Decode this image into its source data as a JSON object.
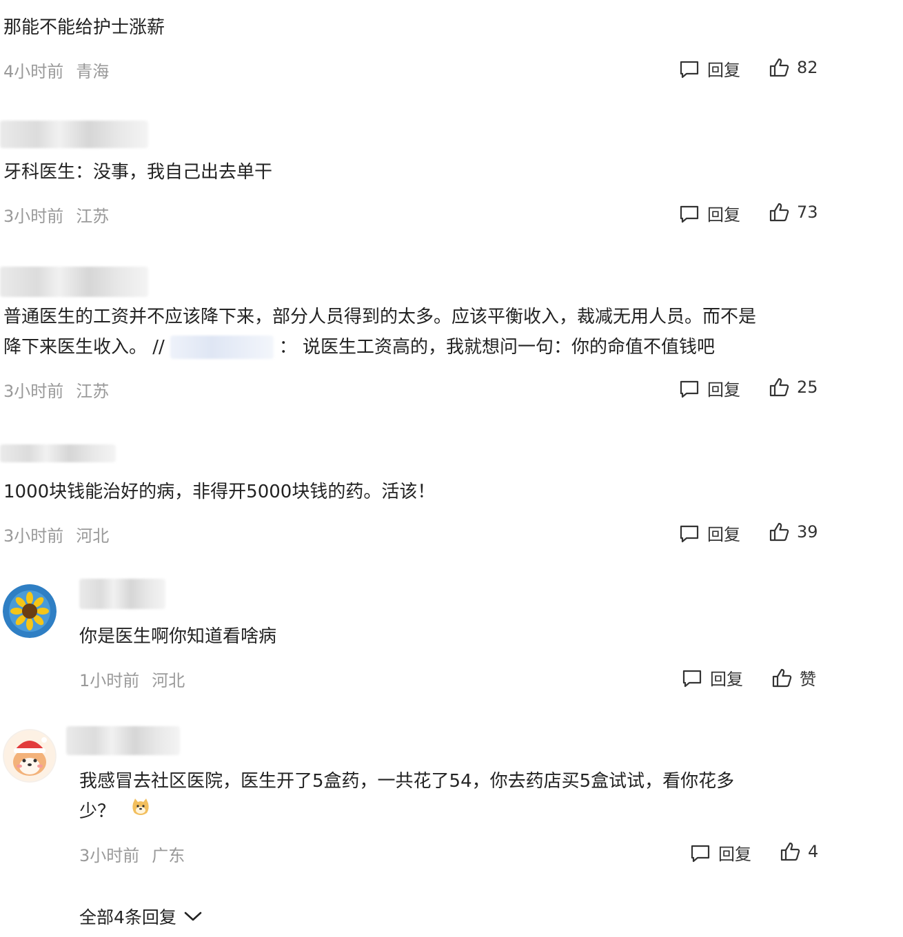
{
  "labels": {
    "reply": "回复",
    "like_zero": "赞"
  },
  "comments": [
    {
      "text": "那能不能给护士涨薪",
      "time": "4小时前",
      "location": "青海",
      "likes": "82"
    },
    {
      "text": "牙科医生：没事，我自己出去单干",
      "time": "3小时前",
      "location": "江苏",
      "likes": "73"
    },
    {
      "text_line1": "普通医生的工资并不应该降下来，部分人员得到的太多。应该平衡收入，裁减无用人员。而不是",
      "text_line2_a": "降下来医生收入。 //",
      "text_line2_b": "： 说医生工资高的，我就想问一句：你的命值不值钱吧",
      "time": "3小时前",
      "location": "江苏",
      "likes": "25"
    },
    {
      "text": "1000块钱能治好的病，非得开5000块钱的药。活该！",
      "time": "3小时前",
      "location": "河北",
      "likes": "39"
    },
    {
      "text": "你是医生啊你知道看啥病",
      "time": "1小时前",
      "location": "河北"
    },
    {
      "text_line1": "我感冒去社区医院，医生开了5盒药，一共花了54，你去药店买5盒试试，看你花多",
      "text_line2": "少？",
      "time": "3小时前",
      "location": "广东",
      "likes": "4"
    }
  ],
  "all_replies": "全部4条回复",
  "icons": {
    "reply": "comment-bubble-icon",
    "like": "thumbs-up-icon",
    "expand": "chevron-down-icon"
  },
  "colors": {
    "meta": "#999999",
    "text": "#222222"
  }
}
